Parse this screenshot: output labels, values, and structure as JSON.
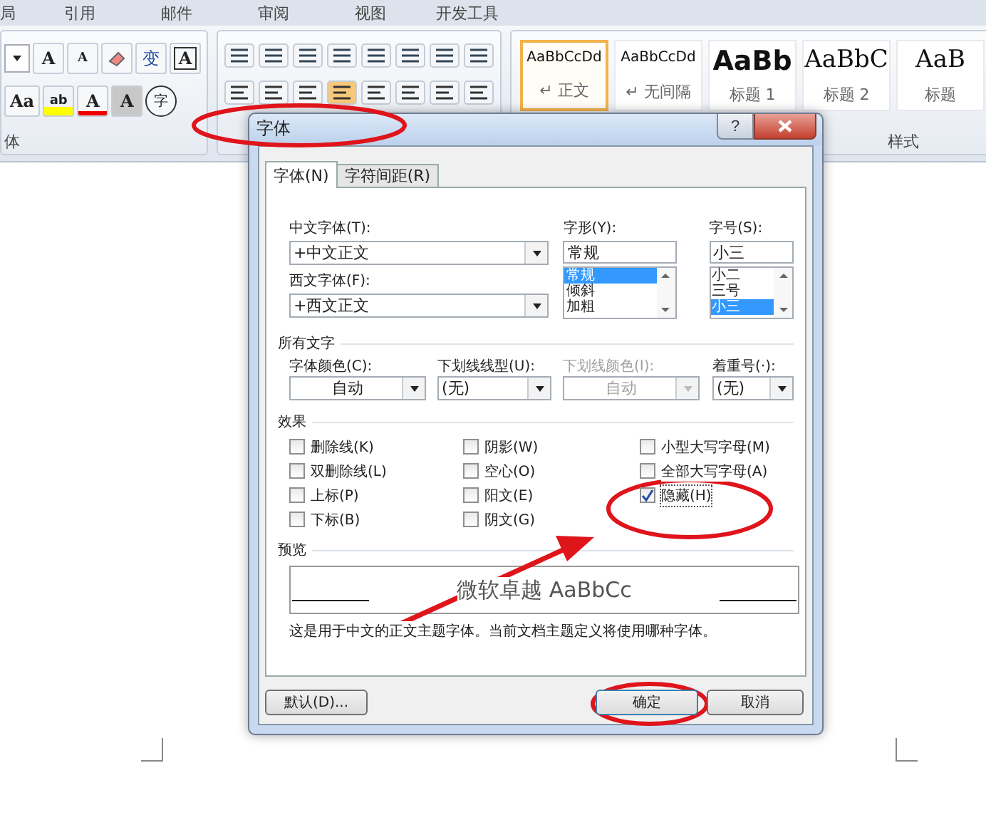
{
  "ribbon": {
    "tabs": [
      {
        "label": "局"
      },
      {
        "label": "引用"
      },
      {
        "label": "邮件"
      },
      {
        "label": "审阅"
      },
      {
        "label": "视图"
      },
      {
        "label": "开发工具"
      }
    ],
    "font_group": {
      "row1": [
        {
          "glyph": "A",
          "kind": "grow"
        },
        {
          "glyph": "A",
          "kind": "shrink"
        },
        {
          "kind": "eraser"
        },
        {
          "glyph": "变",
          "kind": "phonetic"
        },
        {
          "glyph": "A",
          "kind": "border"
        }
      ],
      "row2": [
        {
          "glyph": "Aa",
          "kind": "case"
        },
        {
          "glyph": "ab",
          "kind": "highlight"
        },
        {
          "glyph": "A",
          "kind": "color"
        },
        {
          "glyph": "A",
          "kind": "shade"
        },
        {
          "glyph": "字",
          "kind": "circle"
        }
      ],
      "label": "体"
    },
    "styles": [
      {
        "preview": "AaBbCcDd",
        "name": "↵ 正文",
        "kind": "normal",
        "selected": true
      },
      {
        "preview": "AaBbCcDd",
        "name": "↵ 无间隔",
        "kind": "normal",
        "selected": false
      },
      {
        "preview": "AaBb",
        "name": "标题 1",
        "kind": "heading1",
        "selected": false
      },
      {
        "preview": "AaBbC",
        "name": "标题 2",
        "kind": "heading2",
        "selected": false
      },
      {
        "preview": "AaB",
        "name": "标题",
        "kind": "heading2",
        "selected": false
      }
    ],
    "styles_label": "样式"
  },
  "dialog": {
    "title": "字体",
    "help": "?",
    "tabs": [
      {
        "label": "字体(N)",
        "selected": true
      },
      {
        "label": "字符间距(R)",
        "selected": false
      }
    ],
    "chinese_font": {
      "label": "中文字体(T):",
      "value": "+中文正文"
    },
    "western_font": {
      "label": "西文字体(F):",
      "value": "+西文正文"
    },
    "font_style": {
      "label": "字形(Y):",
      "value": "常规",
      "options": [
        {
          "label": "常规",
          "selected": true
        },
        {
          "label": "倾斜",
          "selected": false
        },
        {
          "label": "加粗",
          "selected": false
        }
      ]
    },
    "font_size": {
      "label": "字号(S):",
      "value": "小三",
      "options": [
        {
          "label": "小二",
          "selected": false
        },
        {
          "label": "三号",
          "selected": false
        },
        {
          "label": "小三",
          "selected": true
        }
      ]
    },
    "all_text": {
      "heading": "所有文字",
      "dropdowns": [
        {
          "label": "字体颜色(C):",
          "value": "自动",
          "disabled": false
        },
        {
          "label": "下划线线型(U):",
          "value": "(无)",
          "disabled": false
        },
        {
          "label": "下划线颜色(I):",
          "value": "自动",
          "disabled": true
        },
        {
          "label": "着重号(·):",
          "value": "(无)",
          "disabled": false
        }
      ]
    },
    "effects": {
      "heading": "效果",
      "columns": [
        [
          {
            "label": "删除线(K)",
            "checked": false
          },
          {
            "label": "双删除线(L)",
            "checked": false
          },
          {
            "label": "上标(P)",
            "checked": false
          },
          {
            "label": "下标(B)",
            "checked": false
          }
        ],
        [
          {
            "label": "阴影(W)",
            "checked": false
          },
          {
            "label": "空心(O)",
            "checked": false
          },
          {
            "label": "阳文(E)",
            "checked": false
          },
          {
            "label": "阴文(G)",
            "checked": false
          }
        ],
        [
          {
            "label": "小型大写字母(M)",
            "checked": false
          },
          {
            "label": "全部大写字母(A)",
            "checked": false
          },
          {
            "label": "隐藏(H)",
            "checked": true
          }
        ]
      ]
    },
    "preview": {
      "heading": "预览",
      "sample": "微软卓越  AaBbCc",
      "note": "这是用于中文的正文主题字体。当前文档主题定义将使用哪种字体。"
    },
    "buttons": [
      {
        "label": "默认(D)...",
        "kind": "default"
      },
      {
        "label": "确定",
        "kind": "ok"
      },
      {
        "label": "取消",
        "kind": "cancel"
      }
    ]
  }
}
